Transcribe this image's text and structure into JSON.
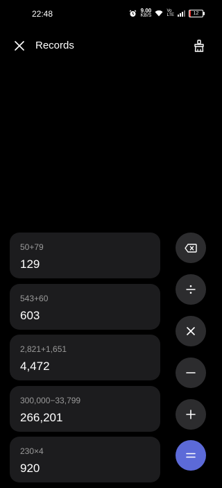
{
  "status": {
    "time": "22:48",
    "net_speed_value": "9.00",
    "net_speed_unit": "KB/S",
    "volte_top": "Vo",
    "volte_bottom": "LTE",
    "battery": "12",
    "battery_level": 0.12,
    "battery_color": "#e53935"
  },
  "header": {
    "title": "Records"
  },
  "records": [
    {
      "expression": "50+79",
      "result": "129"
    },
    {
      "expression": "543+60",
      "result": "603"
    },
    {
      "expression": "2,821+1,651",
      "result": "4,472"
    },
    {
      "expression": "300,000−33,799",
      "result": "266,201"
    },
    {
      "expression": "230×4",
      "result": "920"
    }
  ],
  "keys": {
    "backspace_icon": "backspace-icon",
    "divide_icon": "divide-icon",
    "multiply_icon": "multiply-icon",
    "minus_icon": "minus-icon",
    "plus_icon": "plus-icon",
    "equals_icon": "equals-icon"
  },
  "colors": {
    "background": "#000000",
    "card": "#1c1c1e",
    "key": "#2c2c2e",
    "accent": "#5c6ad8"
  }
}
